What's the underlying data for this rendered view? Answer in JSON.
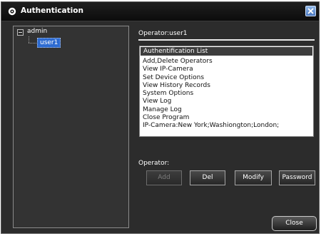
{
  "window": {
    "title": "Authentication",
    "title_icon": "app-logo-icon",
    "close_icon": "close-icon"
  },
  "tree": {
    "root": {
      "label": "admin",
      "expander": "minus"
    },
    "children": [
      {
        "label": "user1",
        "selected": true
      }
    ]
  },
  "operator_heading": "Operator:user1",
  "authentication_list": {
    "header": "Authentification List",
    "items": [
      "Add,Delete Operators",
      "View IP-Camera",
      "Set Device Options",
      "View History Records",
      "System Options",
      "View Log",
      "Manage Log",
      "Close Program",
      "IP-Camera:New York;Washiongton;London;"
    ]
  },
  "operator_section": {
    "label": "Operator:"
  },
  "buttons": {
    "add": "Add",
    "del": "Del",
    "modify": "Modify",
    "password": "Password",
    "close": "Close"
  },
  "colors": {
    "window_bg": "#2c2c2c",
    "titlebar_bg": "#141414",
    "selection": "#2d6bd1",
    "list_bg": "#ffffff",
    "list_header_bg": "#3d3d3d",
    "close_button_blue": "#4a78c0"
  }
}
